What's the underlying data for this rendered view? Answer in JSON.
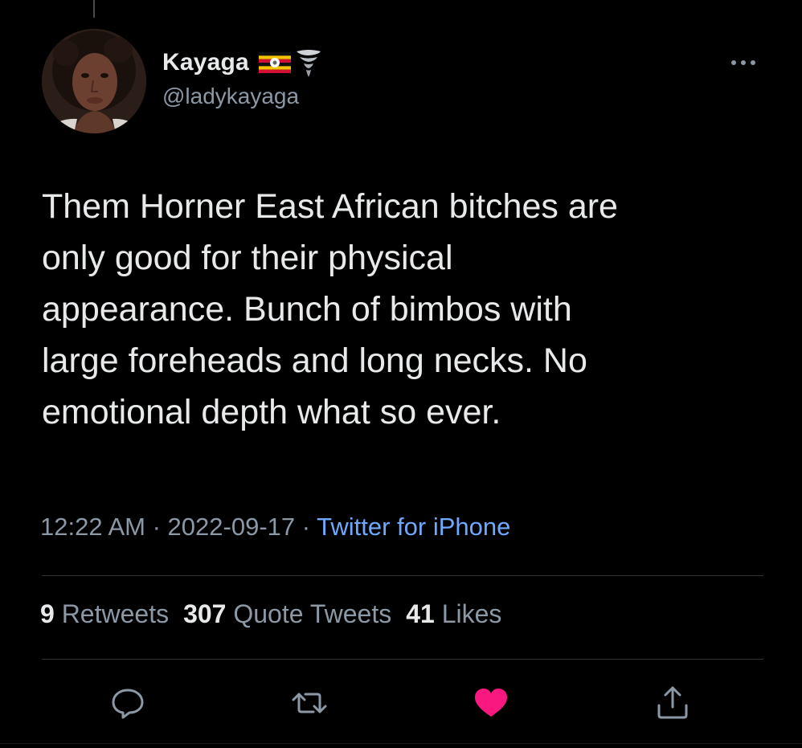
{
  "user": {
    "display_name": "Kayaga",
    "handle": "@ladykayaga",
    "flag_icon": "uganda-flag-icon",
    "badge_icon": "tornado-icon"
  },
  "tweet": {
    "text": "Them Horner East African bitches are\nonly good for their physical\nappearance. Bunch of bimbos with\nlarge foreheads and long necks. No\nemotional depth what so ever.",
    "time": "12:22 AM",
    "separator": " · ",
    "date": "2022-09-17",
    "source": "Twitter for iPhone"
  },
  "stats": {
    "retweets_count": "9",
    "retweets_label": "Retweets",
    "quotes_count": "307",
    "quotes_label": "Quote Tweets",
    "likes_count": "41",
    "likes_label": "Likes"
  },
  "colors": {
    "background": "#000000",
    "text_primary": "#e7e9ea",
    "text_secondary": "#8b98a5",
    "link": "#6fa8ff",
    "like": "#f91880",
    "divider": "#2f3336"
  },
  "actions": {
    "reply_icon": "reply-icon",
    "retweet_icon": "retweet-icon",
    "like_icon": "heart-icon",
    "share_icon": "share-icon",
    "liked": true
  }
}
